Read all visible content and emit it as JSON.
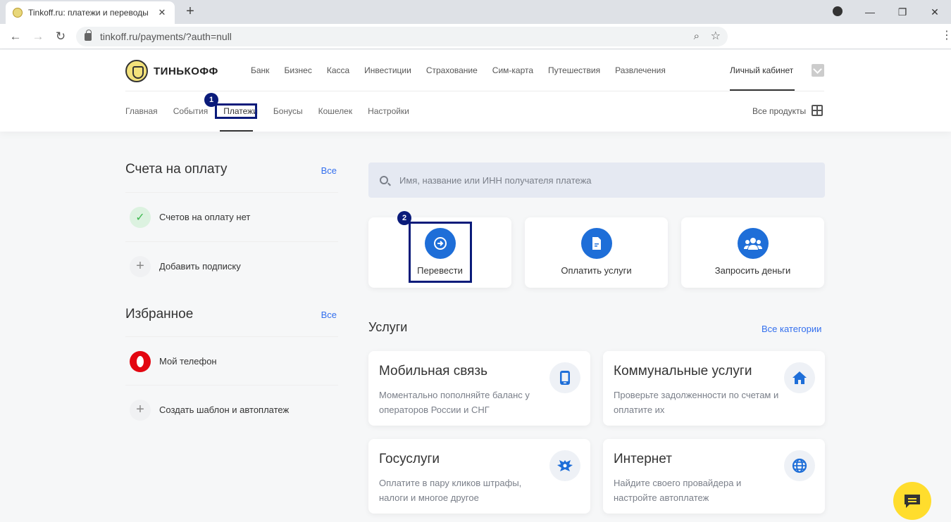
{
  "browser": {
    "tab_title": "Tinkoff.ru: платежи и переводы",
    "tab_close": "✕",
    "new_tab": "+",
    "url": "tinkoff.ru/payments/?auth=null",
    "window_min": "—",
    "window_max": "❐",
    "window_close": "✕"
  },
  "header": {
    "logo_text": "ТИНЬКОФФ",
    "nav": [
      "Банк",
      "Бизнес",
      "Касса",
      "Инвестиции",
      "Страхование",
      "Сим-карта",
      "Путешествия",
      "Развлечения"
    ],
    "cabinet": "Личный кабинет",
    "subnav": [
      "Главная",
      "События",
      "Платежи",
      "Бонусы",
      "Кошелек",
      "Настройки"
    ],
    "all_products": "Все продукты"
  },
  "annotations": {
    "badge1": "1",
    "badge2": "2"
  },
  "left": {
    "invoices_title": "Счета на оплату",
    "invoices_all": "Все",
    "no_invoices": "Счетов на оплату нет",
    "add_subscription": "Добавить подписку",
    "favorites_title": "Избранное",
    "favorites_all": "Все",
    "my_phone": "Мой телефон",
    "create_template": "Создать шаблон и автоплатеж"
  },
  "search": {
    "placeholder": "Имя, название или ИНН получателя платежа"
  },
  "actions": [
    {
      "label": "Перевести",
      "icon": "arrow-right-icon"
    },
    {
      "label": "Оплатить услуги",
      "icon": "document-icon"
    },
    {
      "label": "Запросить деньги",
      "icon": "people-icon"
    }
  ],
  "services": {
    "title": "Услуги",
    "all_categories": "Все категории",
    "items": [
      {
        "title": "Мобильная связь",
        "desc": "Моментально пополняйте баланс у операторов России и СНГ",
        "icon": "phone-icon"
      },
      {
        "title": "Коммунальные услуги",
        "desc": "Проверьте задолженности по счетам и оплатите их",
        "icon": "home-icon"
      },
      {
        "title": "Госуслуги",
        "desc": "Оплатите в пару кликов штрафы, налоги и многое другое",
        "icon": "eagle-icon"
      },
      {
        "title": "Интернет",
        "desc": "Найдите своего провайдера и настройте автоплатеж",
        "icon": "globe-icon"
      }
    ]
  },
  "colors": {
    "accent_blue": "#1e6ed8",
    "link_blue": "#336fee",
    "highlight": "#0a1b7a",
    "chat_yellow": "#ffdd2d"
  }
}
